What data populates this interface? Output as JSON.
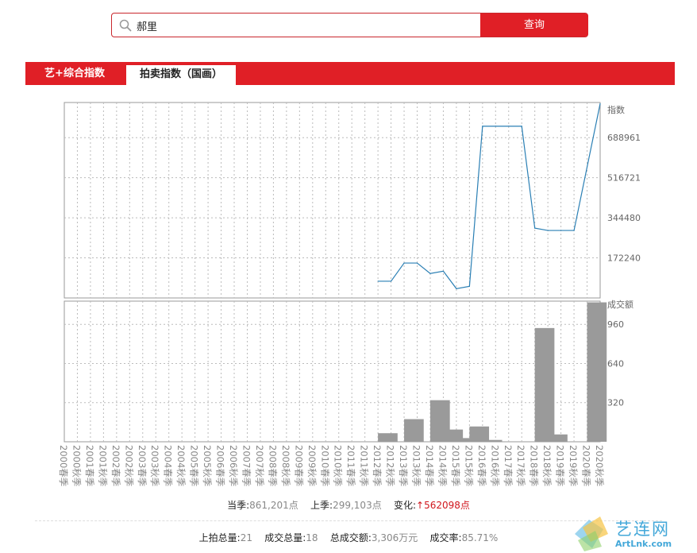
{
  "search": {
    "value": "郝里",
    "button_label": "查询"
  },
  "tabs": [
    {
      "label": "艺+综合指数",
      "active": false
    },
    {
      "label": "拍卖指数（国画）",
      "active": true
    }
  ],
  "colors": {
    "accent": "#e01f26",
    "line": "#2a7fb4",
    "bar": "#9a9a9a",
    "up": "#d0161c",
    "brand": "#44a8d9"
  },
  "chart_data": [
    {
      "type": "line",
      "ylabel": "指数",
      "yticks": [
        172240,
        344480,
        516721,
        688961
      ],
      "ylim": [
        0,
        840000
      ],
      "x": [
        "2000春季",
        "2000秋季",
        "2001春季",
        "2001秋季",
        "2002春季",
        "2002秋季",
        "2003春季",
        "2003秋季",
        "2004春季",
        "2004秋季",
        "2005春季",
        "2005秋季",
        "2006春季",
        "2006秋季",
        "2007春季",
        "2007秋季",
        "2008春季",
        "2008秋季",
        "2009春季",
        "2009秋季",
        "2010春季",
        "2010秋季",
        "2011春季",
        "2011秋季",
        "2012春季",
        "2012秋季",
        "2013春季",
        "2013秋季",
        "2014春季",
        "2014秋季",
        "2015春季",
        "2015秋季",
        "2016春季",
        "2016秋季",
        "2017春季",
        "2017秋季",
        "2018春季",
        "2018秋季",
        "2019春季",
        "2019秋季",
        "2020春季",
        "2020秋季"
      ],
      "series": [
        {
          "values": [
            null,
            null,
            null,
            null,
            null,
            null,
            null,
            null,
            null,
            null,
            null,
            null,
            null,
            null,
            null,
            null,
            null,
            null,
            null,
            null,
            null,
            null,
            null,
            null,
            null,
            null,
            null,
            null,
            null,
            null,
            null,
            null,
            null,
            null,
            null,
            null,
            null,
            null,
            null,
            null,
            null,
            null,
            null,
            null,
            null,
            null,
            null,
            null,
            null,
            null,
            null,
            null,
            null,
            null,
            null,
            null,
            null,
            null,
            null,
            null,
            null,
            null,
            null,
            null,
            null,
            null,
            null,
            null,
            null,
            null,
            null,
            null,
            null,
            null,
            null,
            null,
            null,
            null,
            null,
            null
          ]
        }
      ],
      "line_points": [
        {
          "x": "2012春季",
          "y": 72000
        },
        {
          "x": "2012秋季",
          "y": 72000
        },
        {
          "x": "2013春季",
          "y": 150000
        },
        {
          "x": "2013秋季",
          "y": 150000
        },
        {
          "x": "2014春季",
          "y": 105000
        },
        {
          "x": "2014秋季",
          "y": 115000
        },
        {
          "x": "2015春季",
          "y": 40000
        },
        {
          "x": "2015秋季",
          "y": 50000
        },
        {
          "x": "2016春季",
          "y": 738000
        },
        {
          "x": "2016秋季",
          "y": 738000
        },
        {
          "x": "2017春季",
          "y": 738000
        },
        {
          "x": "2017秋季",
          "y": 738000
        },
        {
          "x": "2018春季",
          "y": 300000
        },
        {
          "x": "2018秋季",
          "y": 290000
        },
        {
          "x": "2019春季",
          "y": 290000
        },
        {
          "x": "2019秋季",
          "y": 290000
        },
        {
          "x": "2020秋季",
          "y": 835000
        }
      ]
    },
    {
      "type": "bar",
      "ylabel": "成交额",
      "yticks": [
        320,
        640,
        960
      ],
      "ylim": [
        0,
        1150
      ],
      "bars": [
        {
          "x": "2012春季",
          "value": 70
        },
        {
          "x": "2013春季",
          "value": 185
        },
        {
          "x": "2014春季",
          "value": 340
        },
        {
          "x": "2014秋季",
          "value": 100
        },
        {
          "x": "2015春季",
          "value": 30
        },
        {
          "x": "2015秋季",
          "value": 125
        },
        {
          "x": "2016春季",
          "value": 15
        },
        {
          "x": "2018春季",
          "value": 930
        },
        {
          "x": "2018秋季",
          "value": 60
        },
        {
          "x": "2020春季",
          "value": 1140
        }
      ]
    }
  ],
  "stats": {
    "current_label": "当季:",
    "current_value": "861,201点",
    "prev_label": "上季:",
    "prev_value": "299,103点",
    "change_label": "变化:",
    "change_arrow": "↑",
    "change_value": "562098点",
    "lots_label": "上拍总量:",
    "lots_value": "21",
    "sold_label": "成交总量:",
    "sold_value": "18",
    "amount_label": "总成交额:",
    "amount_value": "3,306万元",
    "rate_label": "成交率:",
    "rate_value": "85.71%"
  },
  "brand": {
    "name": "艺连网",
    "url": "ArtLnk.com"
  }
}
